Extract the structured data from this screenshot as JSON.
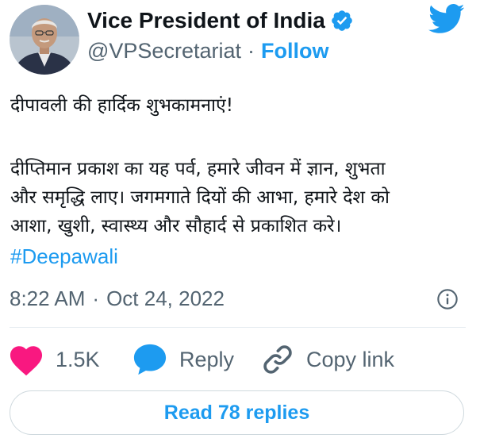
{
  "author": {
    "display_name": "Vice President of India",
    "handle": "@VPSecretariat",
    "separator": "·",
    "follow_label": "Follow",
    "verified": true
  },
  "tweet": {
    "greeting": "दीपावली की हार्दिक शुभकामनाएं!",
    "lines": [
      "दीप्तिमान प्रकाश का यह पर्व, हमारे जीवन में ज्ञान, शुभता",
      "और समृद्धि लाए। जगमगाते दियों की आभा, हमारे देश को",
      "आशा, खुशी, स्वास्थ्य और सौहार्द से प्रकाशित करे।"
    ],
    "hashtag": "#Deepawali"
  },
  "meta": {
    "time": "8:22 AM",
    "separator": "·",
    "date": "Oct 24, 2022"
  },
  "actions": {
    "like_count": "1.5K",
    "reply_label": "Reply",
    "copy_label": "Copy link",
    "read_replies_label": "Read 78 replies"
  },
  "icons": {
    "like": "heart-icon",
    "reply": "speech-bubble-icon",
    "copy": "link-icon",
    "info": "info-icon",
    "brand": "twitter-bird-icon",
    "verified": "verified-badge-icon"
  },
  "colors": {
    "accent": "#1d9bf0",
    "like": "#f91880",
    "text": "#0f1419",
    "muted": "#536471"
  }
}
